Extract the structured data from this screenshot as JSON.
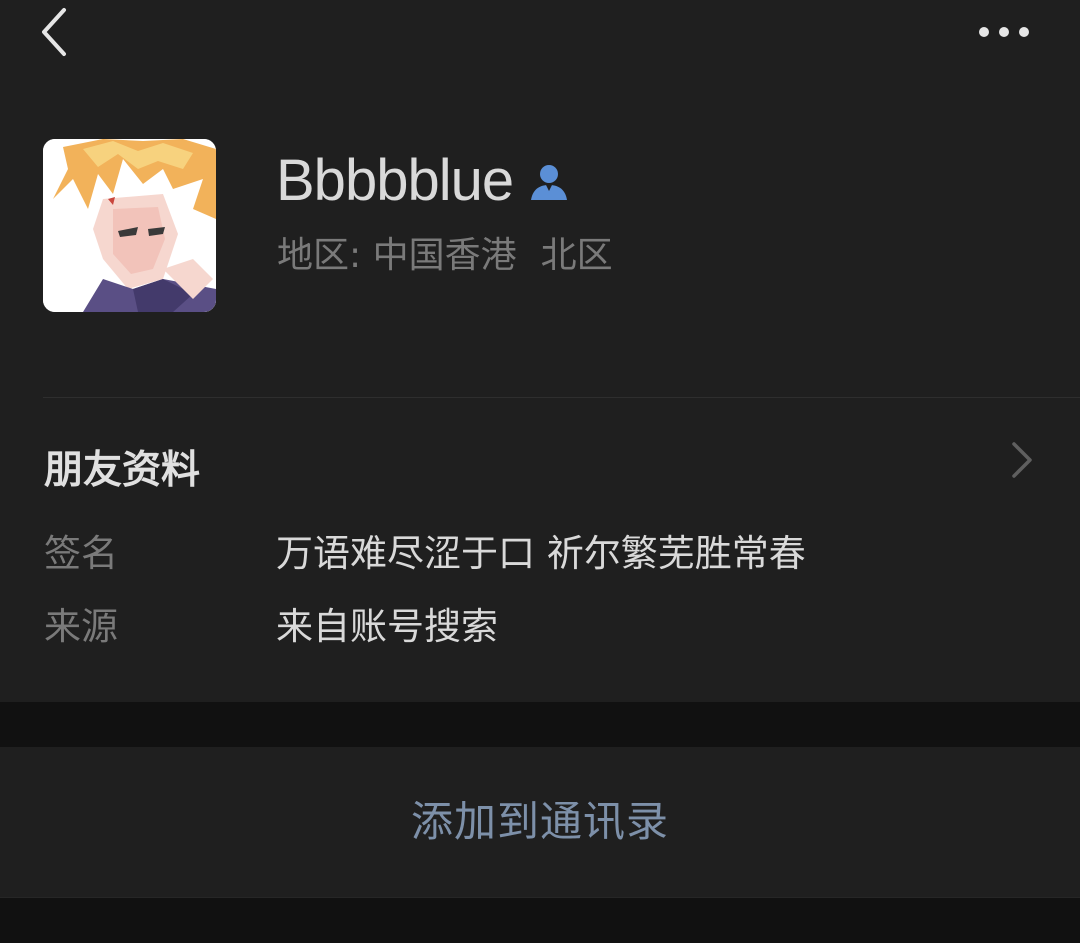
{
  "nav": {
    "back_icon": "chevron-left-icon",
    "more_icon": "more-dots-icon"
  },
  "profile": {
    "nickname": "Bbbbblue",
    "contact_icon": "person-icon",
    "region_label": "地区:",
    "region_value": "中国香港",
    "region_district": "北区"
  },
  "friend_info": {
    "title": "朋友资料",
    "chevron_icon": "chevron-right-icon",
    "rows": [
      {
        "label": "签名",
        "value": "万语难尽涩于口 祈尔繁芜胜常春"
      },
      {
        "label": "来源",
        "value": "来自账号搜索"
      }
    ]
  },
  "actions": {
    "add_to_contacts": "添加到通讯录"
  },
  "colors": {
    "background": "#191919",
    "card": "#1f1f1f",
    "primary_text": "#d9d9d9",
    "secondary_text": "#7a7a7a",
    "link": "#7d90a9",
    "icon_blue": "#5b8fd6"
  }
}
